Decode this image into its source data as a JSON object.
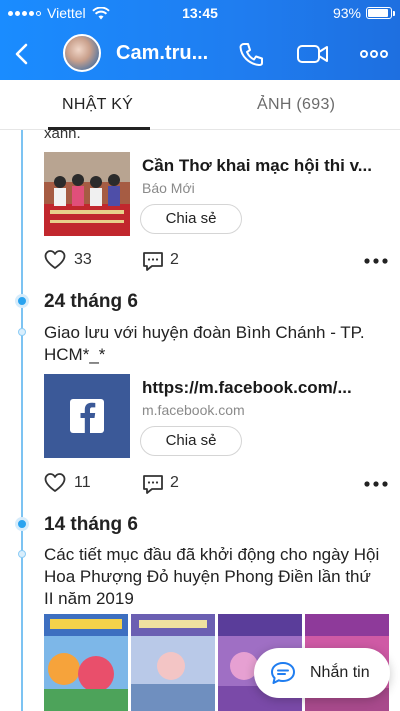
{
  "status_bar": {
    "carrier": "Viettel",
    "time": "13:45",
    "battery_percent": "93%",
    "battery_level": 0.93
  },
  "header": {
    "title": "Cam.tru..."
  },
  "tabs": [
    {
      "label": "NHẬT KÝ",
      "active": true
    },
    {
      "label": "ẢNH (693)",
      "active": false
    }
  ],
  "timeline": {
    "partial_text": "xanh.",
    "posts": [
      {
        "link": {
          "title": "Cần Thơ khai mạc hội thi v...",
          "source": "Báo Mới",
          "share_label": "Chia sẻ"
        },
        "likes": "33",
        "comments": "2"
      },
      {
        "date": "24 tháng 6",
        "text": "Giao lưu với huyện đoàn Bình Chánh - TP. HCM*_*",
        "link": {
          "title": "https://m.facebook.com/...",
          "source": "m.facebook.com",
          "share_label": "Chia sẻ"
        },
        "likes": "11",
        "comments": "2"
      },
      {
        "date": "14 tháng 6",
        "text": "Các tiết mục đầu đã khởi động cho ngày Hội Hoa Phượng Đỏ huyện Phong Điền lần thứ II năm 2019"
      }
    ]
  },
  "chat_button": {
    "label": "Nhắn tin"
  },
  "colors": {
    "header": "#1f7df0",
    "timeline": "#7cc3f2",
    "dot": "#2aa3ef",
    "facebook": "#3b5998"
  },
  "icons": [
    "back-arrow-icon",
    "phone-icon",
    "video-call-icon",
    "more-icon",
    "heart-icon",
    "comment-icon",
    "facebook-logo-icon",
    "chat-bubble-icon"
  ]
}
